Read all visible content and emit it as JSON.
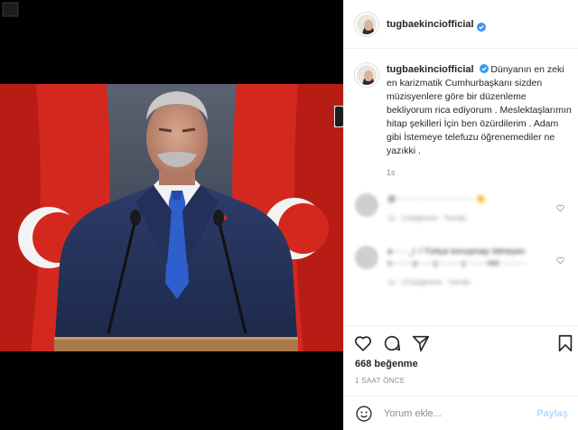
{
  "post": {
    "username": "tugbaekinciofficial",
    "verified_icon": "verified-badge-icon",
    "caption_text": "Dünyanın en zeki en karizmatik Cumhurbaşkanı sizden müzisyenlere göre bir düzenleme bekliyorum rica ediyorum . Meslektaşlarımın hitap şekilleri İçin ben özürdilerim . Adam gibi İstemeye telefuzu öğrenemediler ne yazıkki .",
    "caption_time": "1s",
    "likes": "668 beğenme",
    "posted_ago": "1 SAAT ÖNCE"
  },
  "comments": [
    {
      "text": "@········ ········ ··········· 👏",
      "meta": "1s  ·  3 beğenme  ·  Yanıtla"
    },
    {
      "text": "a······_l··l Türkçe konuşmayı bilmeyen s········y······ç········ ç········nizi ·········",
      "meta": "1s  ·  13 beğenme  ·  Yanıtla"
    }
  ],
  "comment_bar": {
    "placeholder": "Yorum ekle...",
    "post_label": "Paylaş"
  },
  "colors": {
    "verified": "#3897f0",
    "post_disabled": "#b3dbff",
    "muted_text": "#8e8e8e"
  },
  "icons": [
    "close-icon",
    "heart-icon",
    "comment-icon",
    "share-icon",
    "bookmark-icon",
    "emoji-icon",
    "next-arrow-icon"
  ]
}
